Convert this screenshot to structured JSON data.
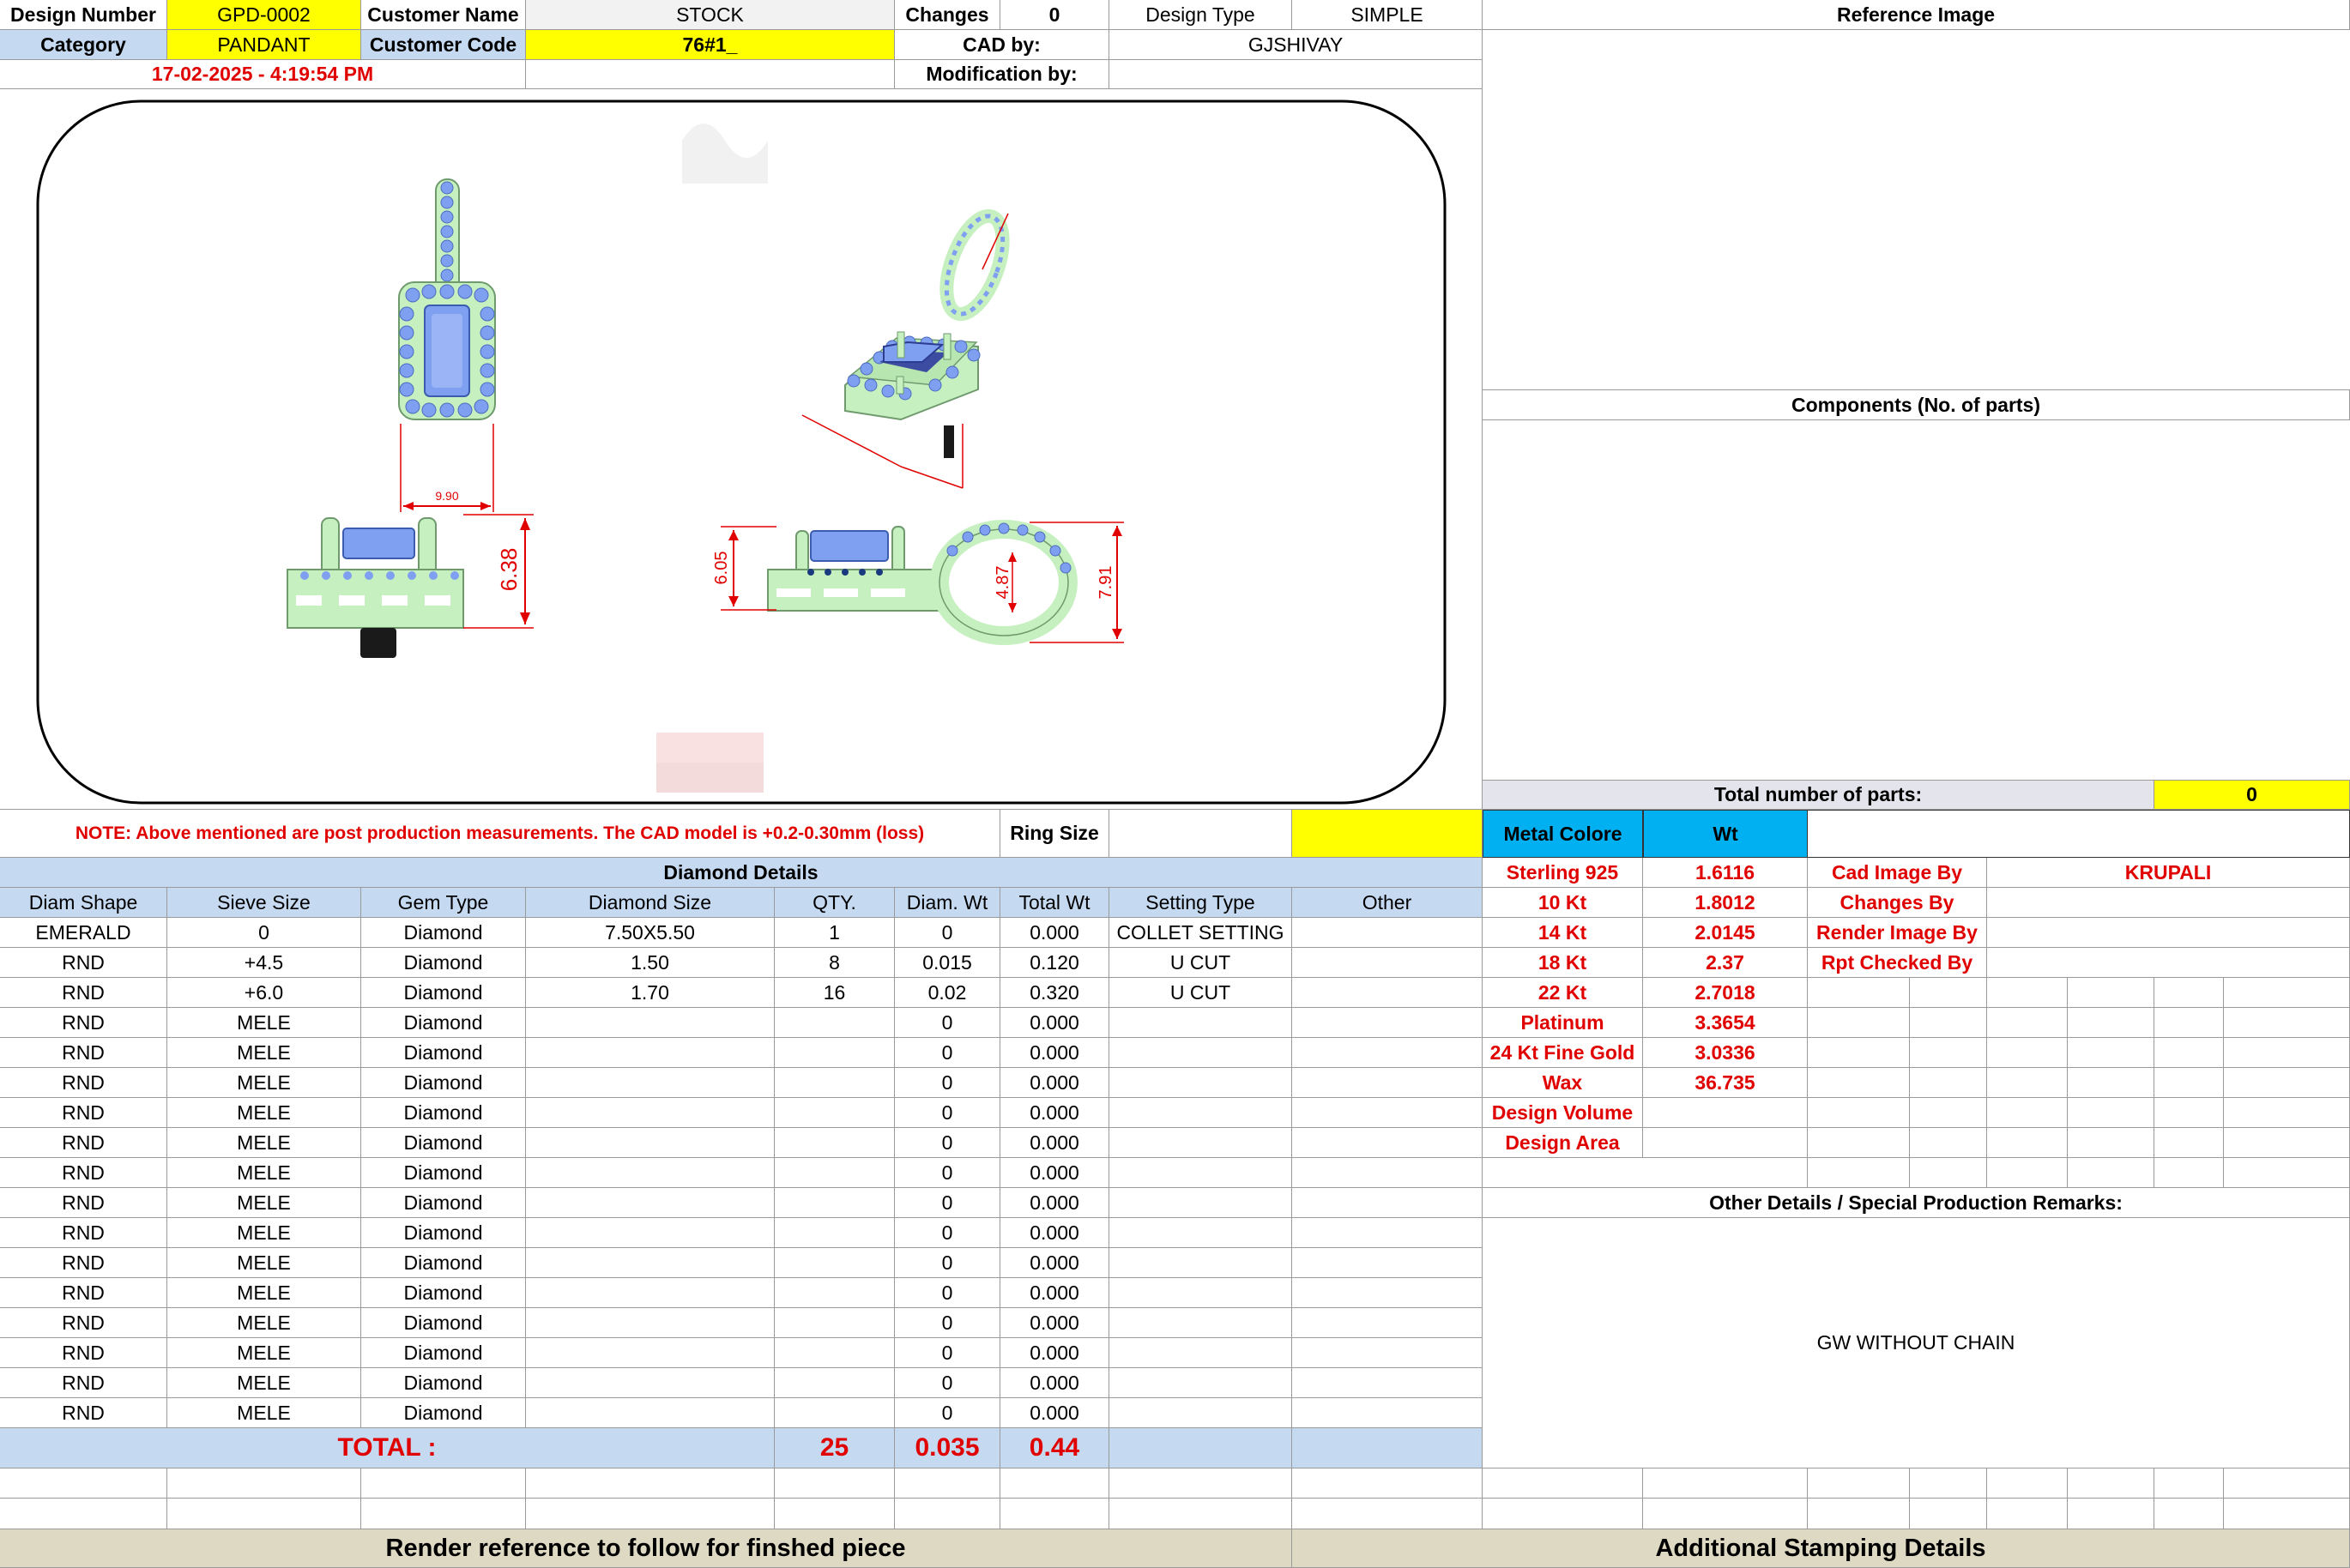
{
  "header": {
    "design_number_label": "Design Number",
    "design_number": "GPD-0002",
    "customer_name_label": "Customer Name",
    "customer_name": "STOCK",
    "changes_label": "Changes",
    "changes": "0",
    "design_type_label": "Design Type",
    "design_type": "SIMPLE",
    "category_label": "Category",
    "category": "PANDANT",
    "customer_code_label": "Customer Code",
    "customer_code": "76#1_",
    "cad_by_label": "CAD by:",
    "cad_by": "GJSHIVAY",
    "timestamp": "17-02-2025 - 4:19:54 PM",
    "modification_by_label": "Modification by:"
  },
  "drawing": {
    "dims": {
      "front_width": "9.90",
      "side_height": "6.38",
      "profile_left": "6.05",
      "loop_inner": "4.87",
      "loop_outer": "7.91"
    }
  },
  "right_panel": {
    "reference_image_label": "Reference Image",
    "components_label": "Components (No. of parts)",
    "total_parts_label": "Total number of parts:",
    "total_parts": "0"
  },
  "note": "NOTE: Above mentioned are post production measurements. The CAD model is +0.2-0.30mm (loss)",
  "ring_size_label": "Ring Size",
  "diamond_details": {
    "title": "Diamond Details",
    "columns": [
      "Diam Shape",
      "Sieve Size",
      "Gem Type",
      "Diamond Size",
      "QTY.",
      "Diam. Wt",
      "Total Wt",
      "Setting Type",
      "Other"
    ],
    "rows": [
      [
        "EMERALD",
        "0",
        "Diamond",
        "7.50X5.50",
        "1",
        "0",
        "0.000",
        "COLLET SETTING",
        ""
      ],
      [
        "RND",
        "+4.5",
        "Diamond",
        "1.50",
        "8",
        "0.015",
        "0.120",
        "U CUT",
        ""
      ],
      [
        "RND",
        "+6.0",
        "Diamond",
        "1.70",
        "16",
        "0.02",
        "0.320",
        "U CUT",
        ""
      ],
      [
        "RND",
        "MELE",
        "Diamond",
        "",
        "",
        "0",
        "0.000",
        "",
        ""
      ],
      [
        "RND",
        "MELE",
        "Diamond",
        "",
        "",
        "0",
        "0.000",
        "",
        ""
      ],
      [
        "RND",
        "MELE",
        "Diamond",
        "",
        "",
        "0",
        "0.000",
        "",
        ""
      ],
      [
        "RND",
        "MELE",
        "Diamond",
        "",
        "",
        "0",
        "0.000",
        "",
        ""
      ],
      [
        "RND",
        "MELE",
        "Diamond",
        "",
        "",
        "0",
        "0.000",
        "",
        ""
      ],
      [
        "RND",
        "MELE",
        "Diamond",
        "",
        "",
        "0",
        "0.000",
        "",
        ""
      ],
      [
        "RND",
        "MELE",
        "Diamond",
        "",
        "",
        "0",
        "0.000",
        "",
        ""
      ],
      [
        "RND",
        "MELE",
        "Diamond",
        "",
        "",
        "0",
        "0.000",
        "",
        ""
      ],
      [
        "RND",
        "MELE",
        "Diamond",
        "",
        "",
        "0",
        "0.000",
        "",
        ""
      ],
      [
        "RND",
        "MELE",
        "Diamond",
        "",
        "",
        "0",
        "0.000",
        "",
        ""
      ],
      [
        "RND",
        "MELE",
        "Diamond",
        "",
        "",
        "0",
        "0.000",
        "",
        ""
      ],
      [
        "RND",
        "MELE",
        "Diamond",
        "",
        "",
        "0",
        "0.000",
        "",
        ""
      ],
      [
        "RND",
        "MELE",
        "Diamond",
        "",
        "",
        "0",
        "0.000",
        "",
        ""
      ],
      [
        "RND",
        "MELE",
        "Diamond",
        "",
        "",
        "0",
        "0.000",
        "",
        ""
      ]
    ],
    "total_label": "TOTAL :",
    "total_qty": "25",
    "total_diam_wt": "0.035",
    "total_wt": "0.44"
  },
  "metal": {
    "colore_label": "Metal Colore",
    "wt_label": "Wt",
    "rows": [
      {
        "name": "Sterling 925",
        "wt": "1.6116"
      },
      {
        "name": "10 Kt",
        "wt": "1.8012"
      },
      {
        "name": "14 Kt",
        "wt": "2.0145"
      },
      {
        "name": "18 Kt",
        "wt": "2.37"
      },
      {
        "name": "22 Kt",
        "wt": "2.7018"
      },
      {
        "name": "Platinum",
        "wt": "3.3654"
      },
      {
        "name": "24 Kt Fine Gold",
        "wt": "3.0336"
      },
      {
        "name": "Wax",
        "wt": "36.735"
      },
      {
        "name": "Design Volume",
        "wt": ""
      },
      {
        "name": "Design Area",
        "wt": ""
      }
    ]
  },
  "staff": {
    "cad_image_by_label": "Cad Image By",
    "cad_image_by": "KRUPALI",
    "changes_by_label": "Changes By",
    "render_image_by_label": "Render Image By",
    "rpt_checked_by_label": "Rpt Checked By"
  },
  "remarks": {
    "label": "Other Details / Special Production Remarks:",
    "text": "GW WITHOUT CHAIN"
  },
  "footer": {
    "render_reference": "Render reference to follow for finshed piece",
    "stamping": "Additional Stamping Details"
  },
  "colors": {
    "yellow": "#ffff00",
    "light_blue": "#c5d9f1",
    "cyan": "#00b0f0",
    "red_text": "#e00000",
    "metal_green": "#c7f0c0",
    "stone_blue": "#7f9ff0"
  }
}
